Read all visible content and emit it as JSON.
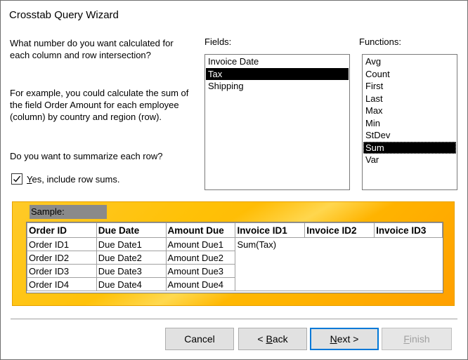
{
  "window": {
    "title": "Crosstab Query Wizard"
  },
  "prompt": {
    "question": "What number do you want calculated for each column and row intersection?",
    "example": "For example, you could calculate the sum of the field Order Amount for each employee (column)  by country and region (row).",
    "summarize_question": "Do you want to summarize each row?",
    "row_sums_prefix": "Y",
    "row_sums_rest": "es, include row sums.",
    "row_sums_checked": true
  },
  "fields": {
    "label": "Fields:",
    "items": [
      "Invoice Date",
      "Tax",
      "Shipping"
    ],
    "selected": "Tax"
  },
  "functions": {
    "label": "Functions:",
    "items": [
      "Avg",
      "Count",
      "First",
      "Last",
      "Max",
      "Min",
      "StDev",
      "Sum",
      "Var"
    ],
    "selected": "Sum"
  },
  "sample": {
    "label": "Sample:",
    "headers": [
      "Order ID",
      "Due Date",
      "Amount Due",
      "Invoice ID1",
      "Invoice ID2",
      "Invoice ID3"
    ],
    "rows": [
      [
        "Order ID1",
        "Due Date1",
        "Amount Due1"
      ],
      [
        "Order ID2",
        "Due Date2",
        "Amount Due2"
      ],
      [
        "Order ID3",
        "Due Date3",
        "Amount Due3"
      ],
      [
        "Order ID4",
        "Due Date4",
        "Amount Due4"
      ]
    ],
    "cell_value": "Sum(Tax)"
  },
  "buttons": {
    "cancel": "Cancel",
    "back_prefix": "< ",
    "back_key": "B",
    "back_rest": "ack",
    "next_key": "N",
    "next_rest": "ext >",
    "finish_key": "F",
    "finish_rest": "inish"
  }
}
